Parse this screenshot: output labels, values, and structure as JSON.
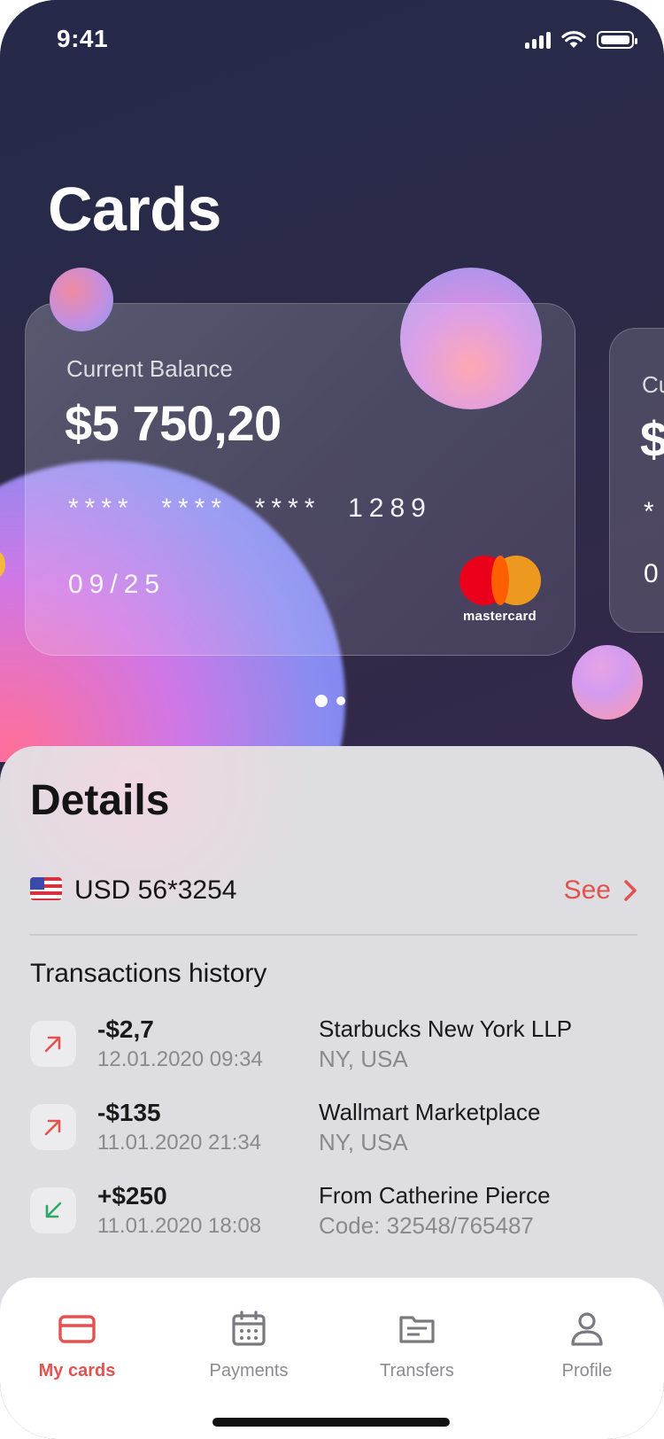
{
  "status_bar": {
    "time": "9:41"
  },
  "page_title": "Cards",
  "cards": [
    {
      "label": "Current Balance",
      "balance": "$5 750,20",
      "number": "****  ****  ****  1289",
      "expiry": "09/25",
      "brand": "mastercard"
    },
    {
      "label": "Cu",
      "balance": "$",
      "number": "*",
      "expiry": "0"
    }
  ],
  "pager": {
    "count": 2,
    "active": 1
  },
  "details": {
    "title": "Details",
    "account": {
      "currency_flag": "us-flag-icon",
      "label": "USD 56*3254",
      "link": "See"
    },
    "transactions_title": "Transactions history",
    "transactions": [
      {
        "direction": "out",
        "amount": "-$2,7",
        "date": "12.01.2020 09:34",
        "name": "Starbucks New York LLP",
        "sub": "NY, USA"
      },
      {
        "direction": "out",
        "amount": "-$135",
        "date": "11.01.2020 21:34",
        "name": "Wallmart Marketplace",
        "sub": "NY, USA"
      },
      {
        "direction": "in",
        "amount": "+$250",
        "date": "11.01.2020 18:08",
        "name": "From Catherine Pierce",
        "sub": "Code: 32548/765487"
      }
    ]
  },
  "tabs": [
    {
      "label": "My cards",
      "icon": "card-icon",
      "active": true
    },
    {
      "label": "Payments",
      "icon": "calendar-icon",
      "active": false
    },
    {
      "label": "Transfers",
      "icon": "document-icon",
      "active": false
    },
    {
      "label": "Profile",
      "icon": "person-icon",
      "active": false
    }
  ],
  "colors": {
    "accent": "#e2524f",
    "incoming": "#2fa866",
    "background": "#dedde2"
  }
}
